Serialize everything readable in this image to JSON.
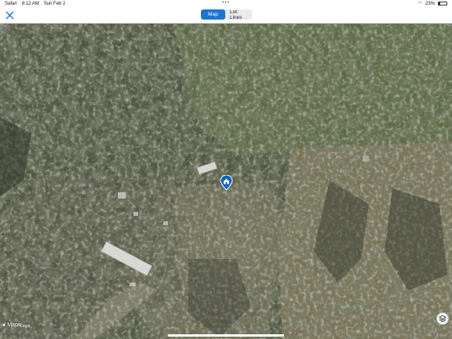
{
  "status_bar": {
    "app": "Safari",
    "time": "8:12 AM",
    "date": "Sun Feb 2",
    "battery": "23%",
    "battery_level": 0.23
  },
  "nav": {
    "close_icon": "close-icon",
    "segments": [
      {
        "label": "Map",
        "active": true
      },
      {
        "label": "Lot Lines",
        "active": false
      }
    ]
  },
  "map": {
    "type": "satellite",
    "pin_icon": "house-icon",
    "attribution": "Maps",
    "legal": "Legal"
  },
  "colors": {
    "accent": "#1e74d6",
    "pin": "#1565c0"
  }
}
